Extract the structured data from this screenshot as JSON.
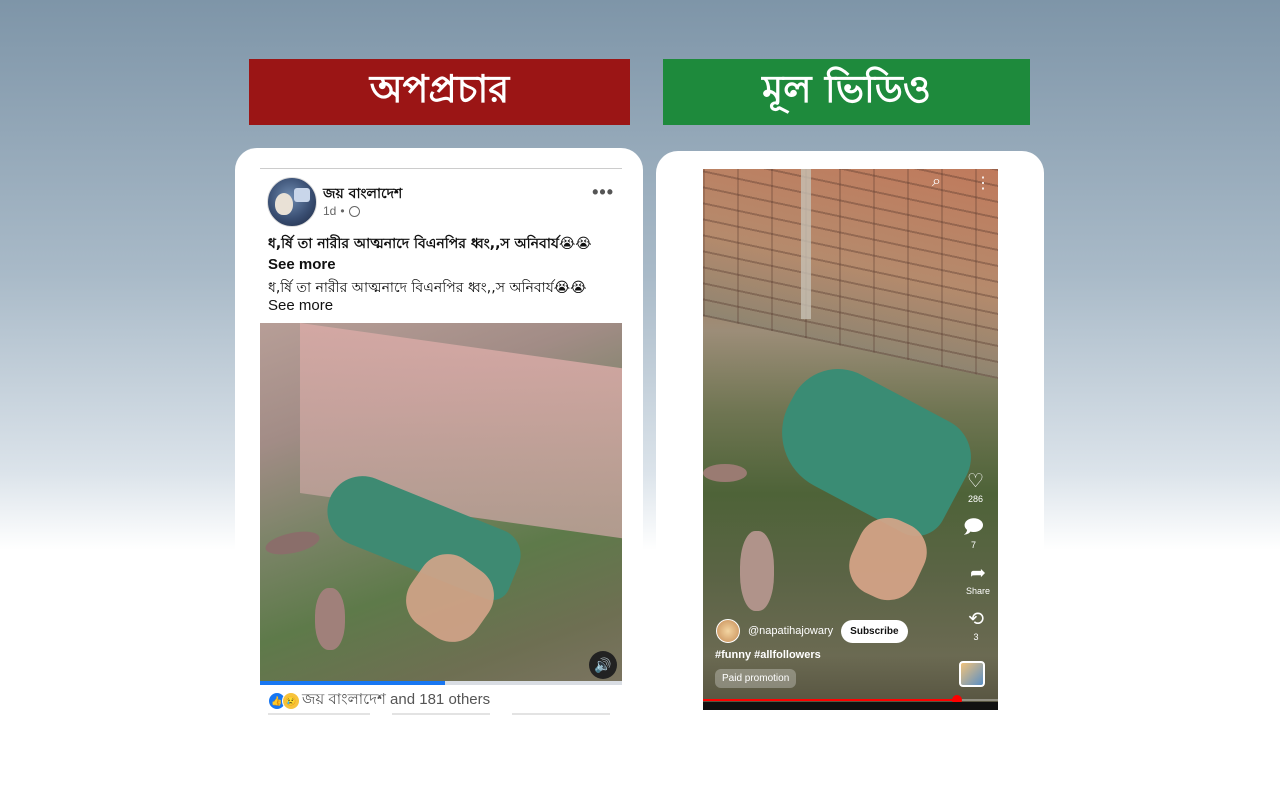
{
  "banners": {
    "left": "অপপ্রচার",
    "right": "মূল ভিডিও"
  },
  "fb_post": {
    "page_name": "জয় বাংলাদেশ",
    "time": "1d",
    "more": "•••",
    "caption_1": "ধ,র্ষি তা নারীর আত্মনাদে বিএনপির ধ্বং,,স অনিবার্য😭😭",
    "see_more_1": "See more",
    "caption_2": "ধ,র্ষি তা নারীর আত্মনাদে বিএনপির ধ্বং,,স অনিবার্য😭😭",
    "see_more_2": "See more",
    "video_progress": 0.51,
    "volume_icon": "🔊",
    "reactions_text": "জয় বাংলাদেশ and 181 others",
    "reaction_icons": [
      "like",
      "sad"
    ]
  },
  "short_video": {
    "top_icons": [
      "search-icon",
      "more-vert-icon"
    ],
    "search_glyph": "⌕",
    "more_glyph": "⋮",
    "like_icon": "♡",
    "like_count": "286",
    "comment_icon": "🗩",
    "comment_count": "7",
    "share_icon": "➦",
    "share_label": "Share",
    "remix_icon": "⟲",
    "remix_count": "3",
    "channel": "@napatihajowary",
    "subscribe": "Subscribe",
    "hashtags": "#funny #allfollowers",
    "paid_label": "Paid promotion",
    "video_progress": 0.86
  },
  "colors": {
    "left_banner": "#9b1515",
    "right_banner": "#1e8a3c",
    "fb_blue": "#1877f2",
    "yt_red": "#ff0000"
  }
}
